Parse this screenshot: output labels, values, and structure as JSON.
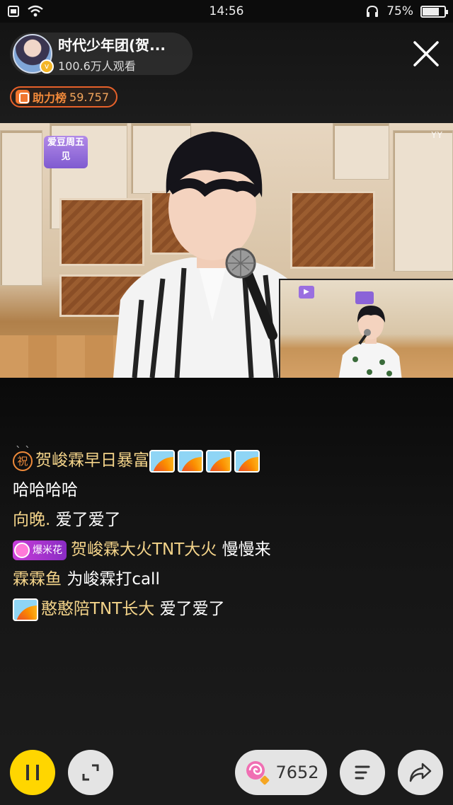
{
  "status_bar": {
    "time": "14:56",
    "battery": "75%",
    "battery_level": 0.75
  },
  "header": {
    "host_name": "时代少年团(贺...",
    "viewers": "100.6万人观看",
    "boost_label": "助力榜",
    "boost_value": "59.757"
  },
  "video": {
    "logo_sign": "爱豆周五见",
    "watermark": "YY"
  },
  "chat": {
    "faded": "` `",
    "messages": [
      {
        "badge": "祝",
        "name": "贺峻霖早日暴富",
        "text": "",
        "rainbows": 4
      },
      {
        "badge": "",
        "name": "",
        "text": "哈哈哈哈",
        "rainbows": 0
      },
      {
        "badge": "",
        "name": "向晚.",
        "text": "爱了爱了",
        "rainbows": 0
      },
      {
        "badge": "爆米花",
        "name": "贺峻霖大火TNT大火",
        "text": "慢慢来",
        "rainbows": 0
      },
      {
        "badge": "",
        "name": "霖霖鱼",
        "text": "为峻霖打call",
        "rainbows": 0
      },
      {
        "badge": "",
        "name": "憨憨陪TNT长大",
        "text": "爱了爱了",
        "rainbows": 1
      }
    ]
  },
  "bottom_bar": {
    "gift_count": "7652"
  },
  "colors": {
    "accent_yellow": "#ffd600",
    "boost_orange": "#e7612a",
    "chat_name": "#f4d48a"
  }
}
